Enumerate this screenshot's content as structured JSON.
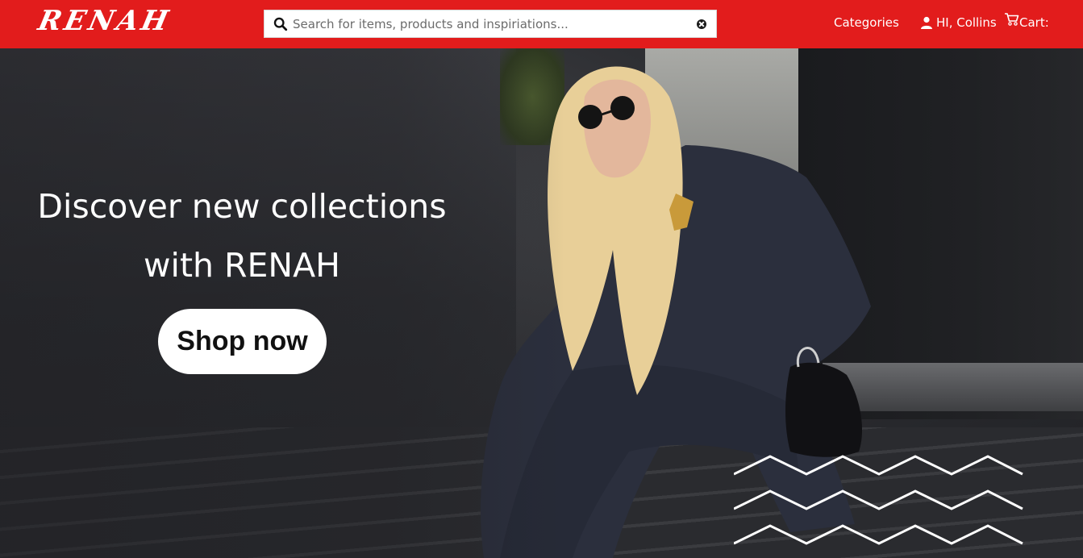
{
  "header": {
    "logo": "RENAH",
    "search": {
      "placeholder": "Search for items, products and inspiriations...",
      "value": ""
    },
    "nav": {
      "categories_label": "Categories",
      "user_label": "HI, Collins",
      "cart_label": "Cart:"
    },
    "icons": [
      "search-icon",
      "clear-icon",
      "user-icon",
      "cart-icon"
    ],
    "brand_color": "#e21c1c"
  },
  "hero": {
    "headline": "Discover new collections with RENAH",
    "cta_label": "Shop now",
    "image": "model-seated-on-steps",
    "decoration": "zigzag-lines-icon"
  }
}
